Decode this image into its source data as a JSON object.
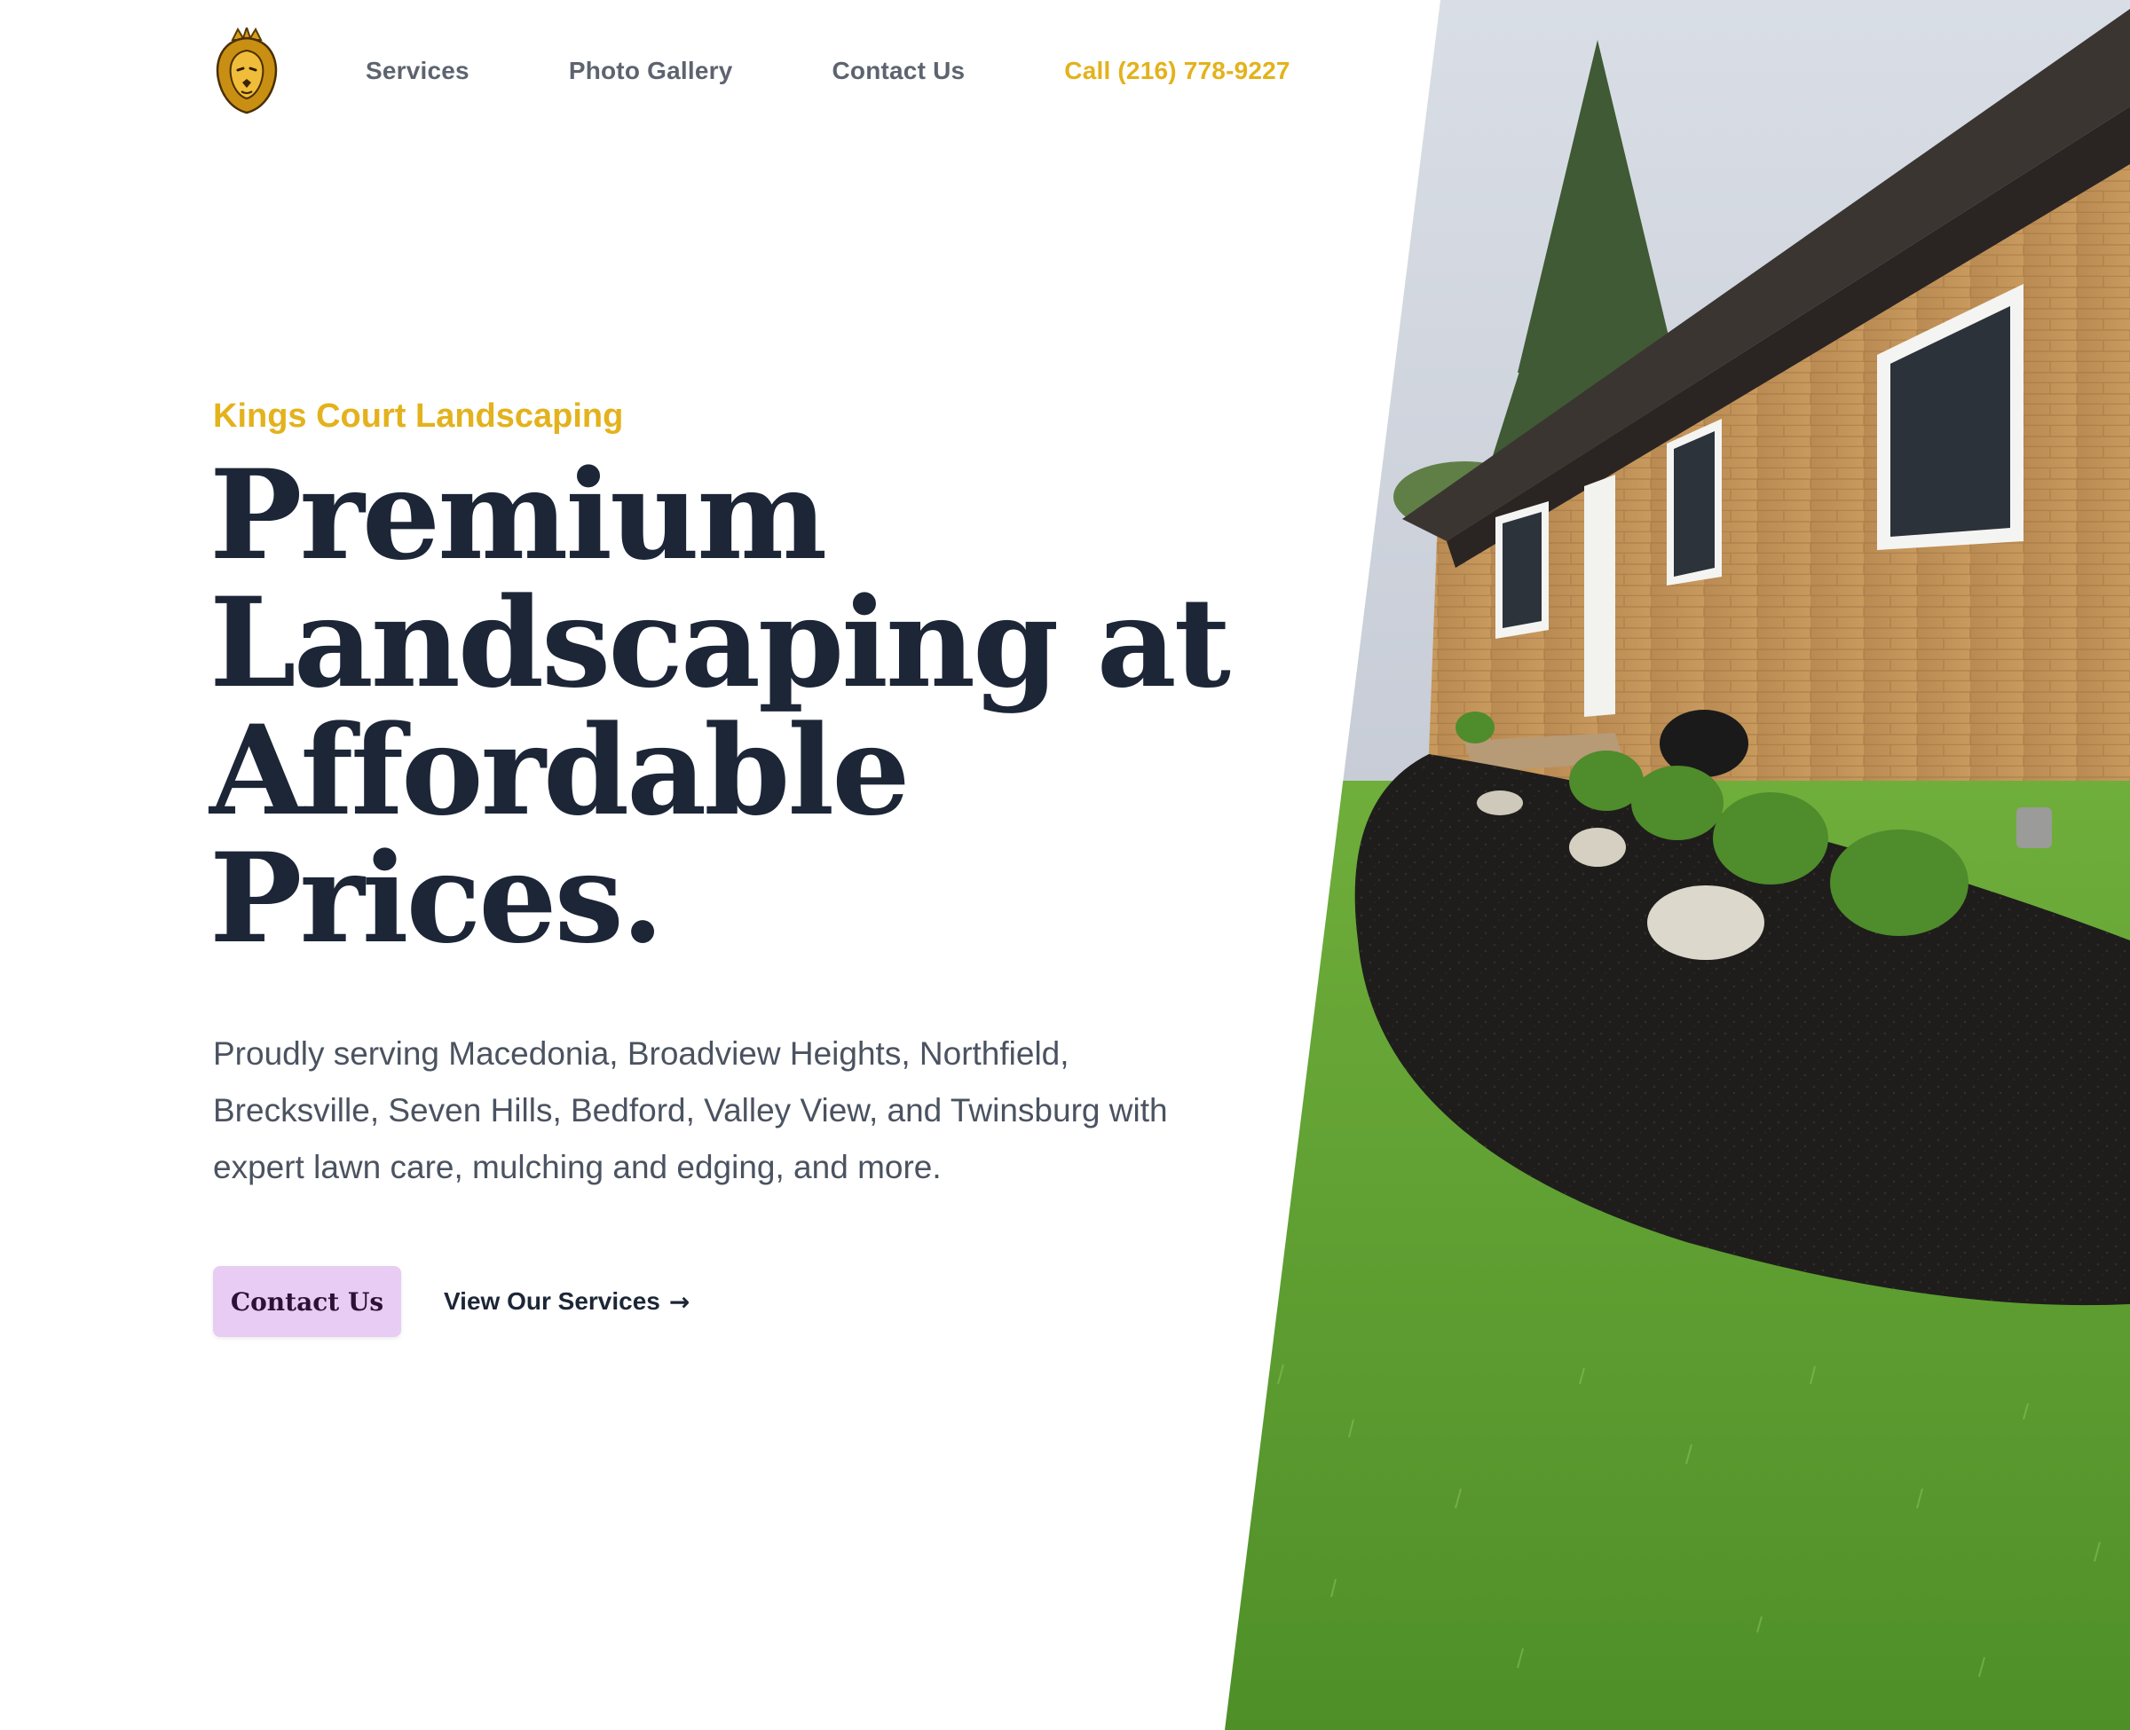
{
  "nav": {
    "links": [
      {
        "label": "Services"
      },
      {
        "label": "Photo Gallery"
      },
      {
        "label": "Contact Us"
      }
    ],
    "call": "Call (216) 778-9227",
    "logo_icon": "crowned-lion-icon"
  },
  "hero": {
    "eyebrow": "Kings Court Landscaping",
    "headline_lines": [
      "Premium",
      "Landscaping at",
      "Affordable",
      "Prices."
    ],
    "lede_lines": [
      "Proudly serving Macedonia, Broadview Heights, Northfield,",
      "Brecksville, Seven Hills, Bedford, Valley View, and Twinsburg with",
      "expert lawn care, mulching and edging, and more."
    ],
    "primary_cta": "Contact Us",
    "secondary_cta": "View Our Services",
    "secondary_cta_icon": "arrow-right-icon"
  },
  "colors": {
    "accent": "#e3b21c",
    "heading": "#1c2637",
    "body": "#4b5361",
    "nav": "#5d6470",
    "button_bg": "#e8ccf3"
  }
}
